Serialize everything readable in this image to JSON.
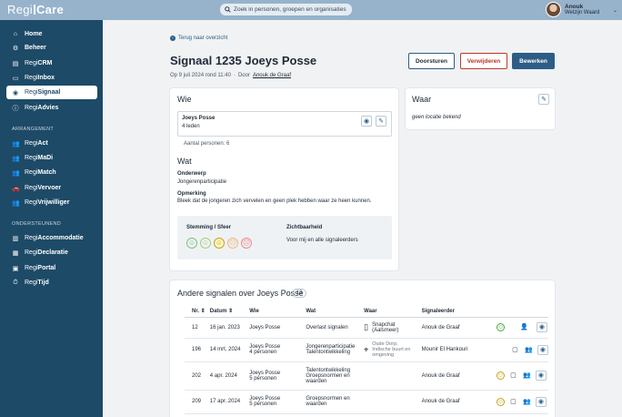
{
  "app": {
    "logo_prefix": "Regi",
    "logo_suffix": "Care"
  },
  "search": {
    "placeholder": "Zoek in personen, groepen en organisaties"
  },
  "user": {
    "name": "Anouk",
    "org": "Welzijn Waard"
  },
  "sidebar": {
    "items": [
      {
        "prefix": "",
        "suffix": "Home",
        "icon": "home-icon"
      },
      {
        "prefix": "",
        "suffix": "Beheer",
        "icon": "gear-icon"
      },
      {
        "prefix": "Regi",
        "suffix": "CRM",
        "icon": "id-card-icon"
      },
      {
        "prefix": "Regi",
        "suffix": "Inbox",
        "icon": "inbox-icon"
      },
      {
        "prefix": "Regi",
        "suffix": "Signaal",
        "icon": "eye-icon",
        "active": true
      },
      {
        "prefix": "Regi",
        "suffix": "Advies",
        "icon": "info-icon"
      }
    ],
    "heading_arrangement": "ARRANGEMENT",
    "arrangement_items": [
      {
        "prefix": "Regi",
        "suffix": "Act",
        "icon": "users-icon"
      },
      {
        "prefix": "Regi",
        "suffix": "MaDi",
        "icon": "users-icon"
      },
      {
        "prefix": "Regi",
        "suffix": "Match",
        "icon": "users-icon"
      },
      {
        "prefix": "Regi",
        "suffix": "Vervoer",
        "icon": "car-icon"
      },
      {
        "prefix": "Regi",
        "suffix": "Vrijwilliger",
        "icon": "users-icon"
      }
    ],
    "heading_support": "ONDERSTEUNEND",
    "support_items": [
      {
        "prefix": "Regi",
        "suffix": "Accommodatie",
        "icon": "building-icon"
      },
      {
        "prefix": "Regi",
        "suffix": "Declaratie",
        "icon": "calculator-icon"
      },
      {
        "prefix": "Regi",
        "suffix": "Portal",
        "icon": "portal-icon"
      },
      {
        "prefix": "Regi",
        "suffix": "Tijd",
        "icon": "stopwatch-icon"
      }
    ]
  },
  "main": {
    "back_link": "Terug naar overzicht",
    "title": "Signaal 1235 Joeys Posse",
    "meta_date": "Op 9 juli 2024 rond 11:40",
    "meta_sep": "·",
    "meta_by": "Door",
    "meta_author": "Anouk de Graaf",
    "buttons": {
      "forward": "Doorsturen",
      "delete": "Verwijderen",
      "edit": "Bewerken"
    }
  },
  "wie_card": {
    "title": "Wie",
    "group_name": "Joeys Posse",
    "group_members": "4 leden",
    "persons_label": "Aantal personen:",
    "persons_value": "6",
    "wat_title": "Wat",
    "subject_label": "Onderwerp",
    "subject_value": "Jongerenparticipatie",
    "remark_label": "Opmerking",
    "remark_value": "Bleek dat de jongeren zich vervelen en geen plek hebben waar ze heen kunnen.",
    "mood_label": "Stemming / Sfeer",
    "mood_selected_index": 2,
    "visibility_label": "Zichtbaarheid",
    "visibility_value": "Voor mij en alle signaleerders"
  },
  "waar_card": {
    "title": "Waar",
    "no_location": "geen locatie bekend"
  },
  "others": {
    "title": "Andere signalen over Joeys Posse",
    "count": "13",
    "columns": [
      "Nr.",
      "Datum",
      "Wie",
      "Wat",
      "Waar",
      "Signaleerder"
    ],
    "rows": [
      {
        "nr": "12",
        "date": "16 jan. 2023",
        "wie": "Joeys Posse",
        "wie2": "",
        "wat": "Overlast signalen",
        "wat2": "",
        "waar_icon": "phone-icon",
        "waar": "Snapchat",
        "waar2": "(Aalsmeer)",
        "waar_muted": false,
        "signaler": "Anouk de Graaf",
        "icons": [
          "smiley-icon",
          "person-icon",
          "eye-icon"
        ]
      },
      {
        "nr": "196",
        "date": "14 mrt. 2024",
        "wie": "Joeys Posse",
        "wie2": "4 personen",
        "wat": "Jongerenparticipatie",
        "wat2": "Talentontwikkeling",
        "waar_icon": "map-pin-icon",
        "waar": "Oude Dorp,",
        "waar2": "Indische buurt en omgeving",
        "waar_muted": true,
        "signaler": "Mounir El Hankouri",
        "icons": [
          "comment-icon",
          "users-icon",
          "eye-icon"
        ]
      },
      {
        "nr": "202",
        "date": "4 apr. 2024",
        "wie": "Joeys Posse",
        "wie2": "5 personen",
        "wat": "Talentontwikkeling",
        "wat2": "Groepsnormen en waarden",
        "waar_icon": "",
        "waar": "",
        "waar2": "",
        "waar_muted": false,
        "signaler": "Anouk de Graaf",
        "icons": [
          "smiley-icon",
          "comment-icon",
          "users-icon",
          "eye-icon"
        ]
      },
      {
        "nr": "209",
        "date": "17 apr. 2024",
        "wie": "Joeys Posse",
        "wie2": "5 personen",
        "wat": "Groepsnormen en",
        "wat2": "waarden",
        "waar_icon": "",
        "waar": "",
        "waar2": "",
        "waar_muted": false,
        "signaler": "Anouk de Graaf",
        "icons": [
          "smiley-icon",
          "comment-icon",
          "users-icon",
          "eye-icon"
        ]
      }
    ]
  },
  "colors": {
    "sidebar": "#1d4a67",
    "topbar": "#97b3cc",
    "primary": "#2d5d86",
    "danger": "#c0392b"
  }
}
